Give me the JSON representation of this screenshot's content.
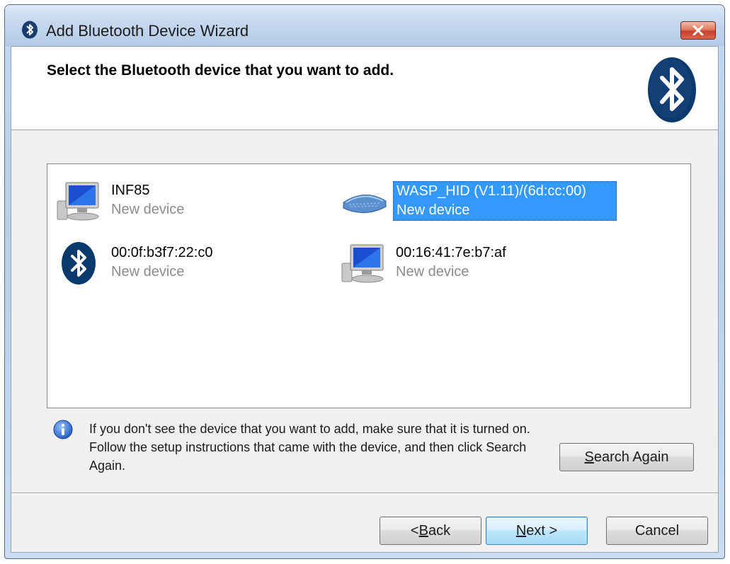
{
  "window": {
    "title": "Add Bluetooth Device Wizard"
  },
  "header": {
    "instruction": "Select the Bluetooth device that you want to add."
  },
  "devices": [
    {
      "name": "INF85",
      "status": "New device",
      "icon": "computer-icon",
      "selected": false
    },
    {
      "name": "WASP_HID (V1.11)/(6d:cc:00)",
      "status": "New device",
      "icon": "keyboard-icon",
      "selected": true
    },
    {
      "name": "00:0f:b3f7:22:c0",
      "status": "New device",
      "icon": "bluetooth-icon",
      "selected": false
    },
    {
      "name": "00:16:41:7e:b7:af",
      "status": "New device",
      "icon": "computer-icon",
      "selected": false
    }
  ],
  "info": {
    "icon": "info-icon",
    "text": "If you don't see the device that you want to add, make sure that it is turned on. Follow the setup instructions that came with the device, and then click Search Again."
  },
  "buttons": {
    "search_again": {
      "pre": "",
      "key": "S",
      "post": "earch Again"
    },
    "back": {
      "pre": "< ",
      "key": "B",
      "post": "ack"
    },
    "next": {
      "pre": "",
      "key": "N",
      "post": "ext >"
    },
    "cancel": "Cancel"
  },
  "colors": {
    "selection": "#3399ff",
    "bluetooth_brand": "#0a3a6b",
    "status_text": "#8c8c8c"
  }
}
